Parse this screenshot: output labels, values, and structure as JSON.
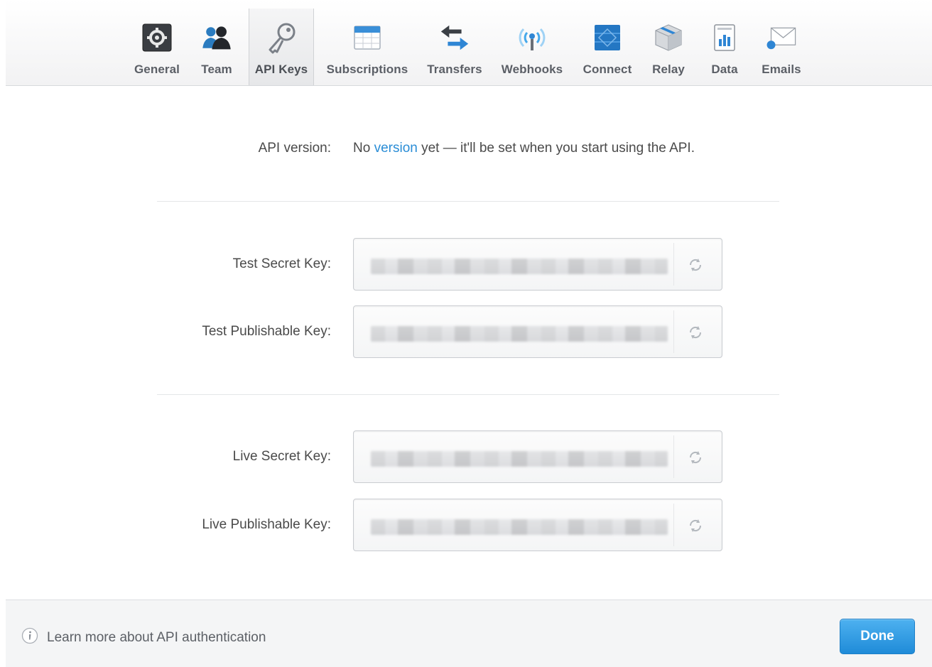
{
  "tabs": [
    {
      "label": "General",
      "icon": "gear-icon"
    },
    {
      "label": "Team",
      "icon": "team-icon"
    },
    {
      "label": "API Keys",
      "icon": "key-icon",
      "active": true
    },
    {
      "label": "Subscriptions",
      "icon": "calendar-icon"
    },
    {
      "label": "Transfers",
      "icon": "transfer-arrows-icon"
    },
    {
      "label": "Webhooks",
      "icon": "antenna-icon"
    },
    {
      "label": "Connect",
      "icon": "connect-icon"
    },
    {
      "label": "Relay",
      "icon": "box-icon"
    },
    {
      "label": "Data",
      "icon": "data-chart-icon"
    },
    {
      "label": "Emails",
      "icon": "envelope-icon"
    }
  ],
  "api_version": {
    "label": "API version:",
    "prefix": "No",
    "link": "version",
    "suffix": "yet — it'll be set when you start using the API."
  },
  "keys": {
    "test_secret": {
      "label": "Test Secret Key:"
    },
    "test_publishable": {
      "label": "Test Publishable Key:"
    },
    "live_secret": {
      "label": "Live Secret Key:"
    },
    "live_publishable": {
      "label": "Live Publishable Key:"
    }
  },
  "footer": {
    "info_text": "Learn more about API authentication",
    "done_label": "Done"
  },
  "colors": {
    "accent": "#2a8dd6",
    "done_button": "#2592dc"
  }
}
